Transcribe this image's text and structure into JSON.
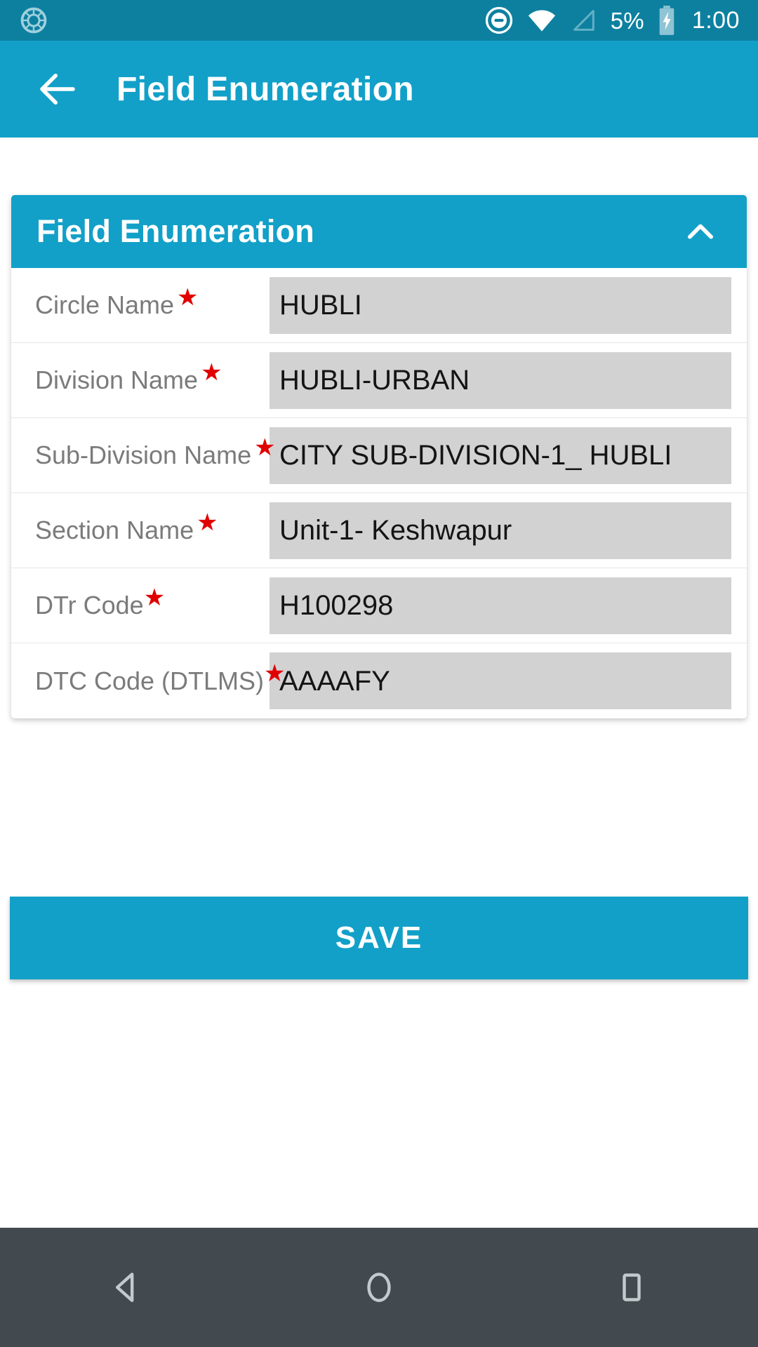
{
  "status_bar": {
    "dnd_label": "do-not-disturb",
    "wifi_label": "wifi",
    "signal_label": "cellular-signal",
    "battery_percent": "5%",
    "battery_label": "battery-charging",
    "clock": "1:00",
    "background": "#0d80a0"
  },
  "app_bar": {
    "back_label": "back",
    "title": "Field Enumeration",
    "background": "#12a0c8"
  },
  "card": {
    "header_title": "Field Enumeration",
    "toggle_state": "expanded",
    "header_background": "#12a0c8",
    "required_marker": "★",
    "rows": [
      {
        "label": "Circle Name",
        "value": "HUBLI",
        "required": true,
        "star_tight": false
      },
      {
        "label": "Division Name",
        "value": "HUBLI-URBAN",
        "required": true,
        "star_tight": false
      },
      {
        "label": "Sub-Division Name",
        "value": "CITY SUB-DIVISION-1_ HUBLI",
        "required": true,
        "star_tight": false
      },
      {
        "label": "Section Name",
        "value": "Unit-1- Keshwapur",
        "required": true,
        "star_tight": false
      },
      {
        "label": "DTr Code",
        "value": "H100298",
        "required": true,
        "star_tight": true
      },
      {
        "label": "DTC Code (DTLMS)",
        "value": "AAAAFY",
        "required": true,
        "star_tight": true
      }
    ]
  },
  "save_button": {
    "label": "SAVE",
    "background": "#12a0c8"
  },
  "nav_bar": {
    "background": "#424a4f",
    "back_label": "navigation-back",
    "home_label": "navigation-home",
    "recents_label": "navigation-recents"
  },
  "colors": {
    "accent": "#12a0c8",
    "status_bar": "#0d80a0",
    "input_background": "#d2d2d2",
    "label_text": "#7b7b7b",
    "required_star": "#e00000",
    "nav_bar": "#424a4f"
  }
}
